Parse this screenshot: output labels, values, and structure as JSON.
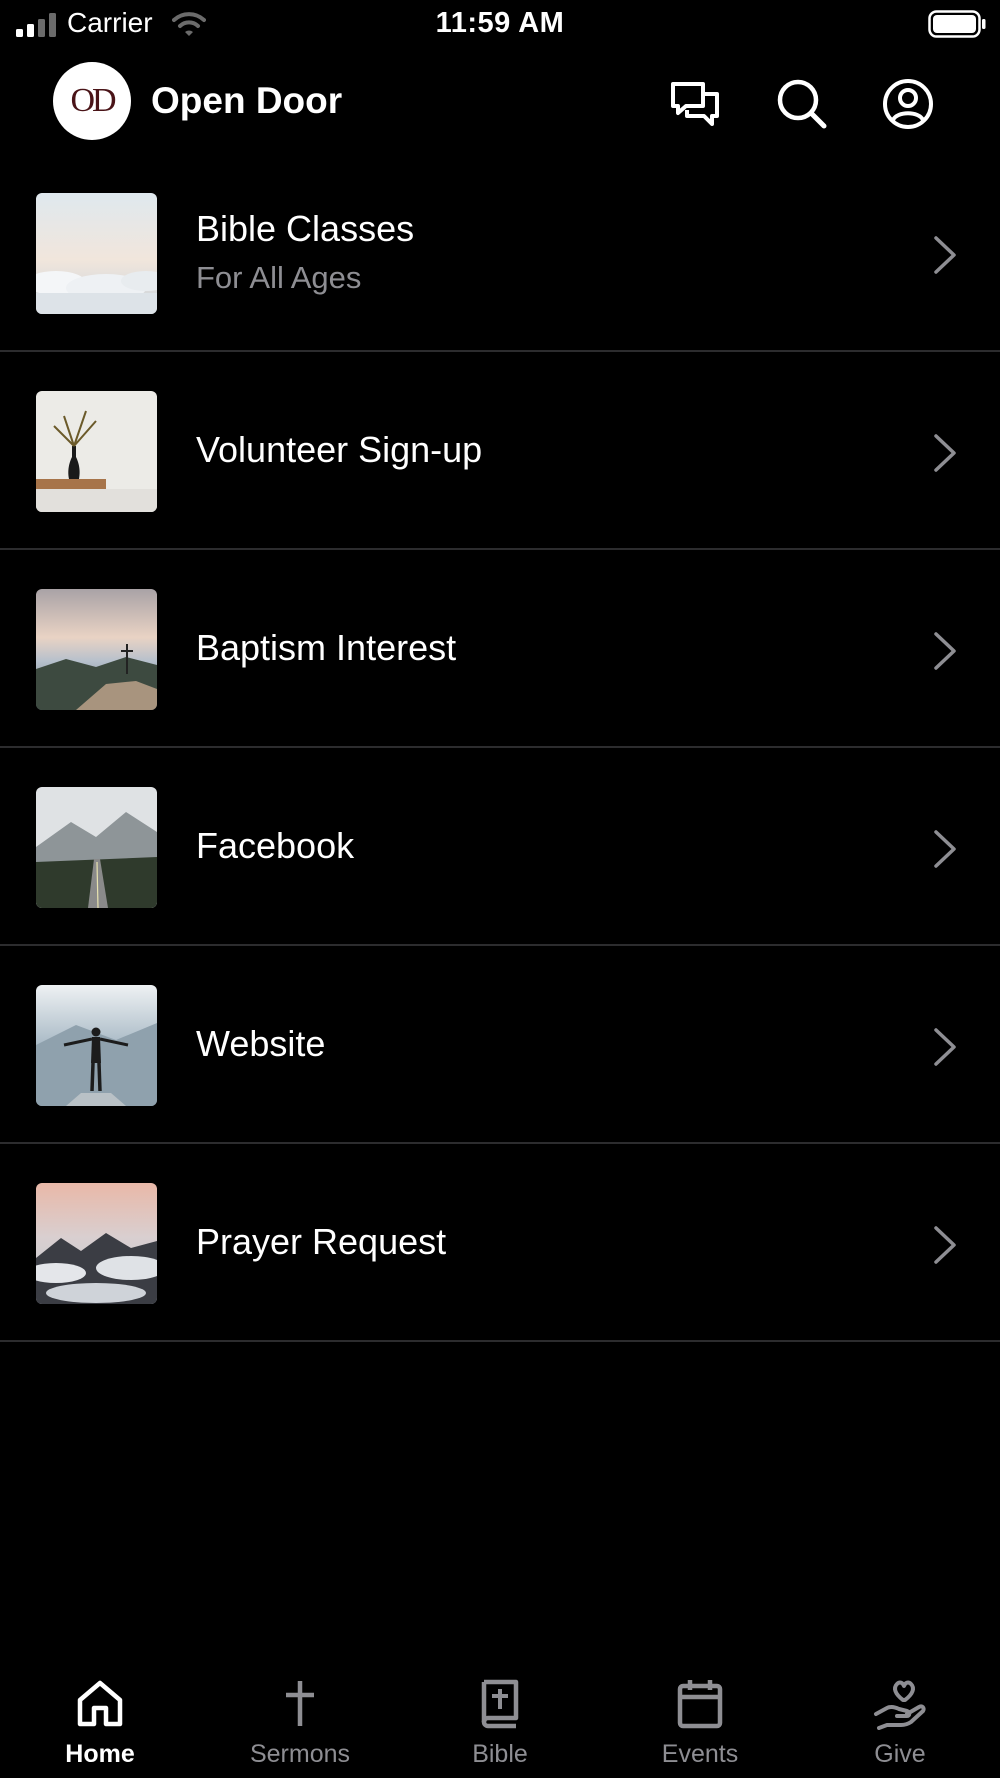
{
  "status_bar": {
    "carrier": "Carrier",
    "time": "11:59 AM"
  },
  "header": {
    "logo_text": "OD",
    "title": "Open Door"
  },
  "list": [
    {
      "title": "Bible Classes",
      "subtitle": "For All Ages"
    },
    {
      "title": "Volunteer Sign-up",
      "subtitle": ""
    },
    {
      "title": "Baptism Interest",
      "subtitle": ""
    },
    {
      "title": "Facebook",
      "subtitle": ""
    },
    {
      "title": "Website",
      "subtitle": ""
    },
    {
      "title": "Prayer Request",
      "subtitle": ""
    }
  ],
  "tabs": [
    {
      "label": "Home",
      "icon": "home-icon",
      "active": true
    },
    {
      "label": "Sermons",
      "icon": "cross-icon",
      "active": false
    },
    {
      "label": "Bible",
      "icon": "bible-icon",
      "active": false
    },
    {
      "label": "Events",
      "icon": "calendar-icon",
      "active": false
    },
    {
      "label": "Give",
      "icon": "give-icon",
      "active": false
    }
  ],
  "colors": {
    "background": "#000000",
    "divider": "#2c2c2e",
    "muted": "#8e8e93",
    "logo": "#4a1418"
  }
}
